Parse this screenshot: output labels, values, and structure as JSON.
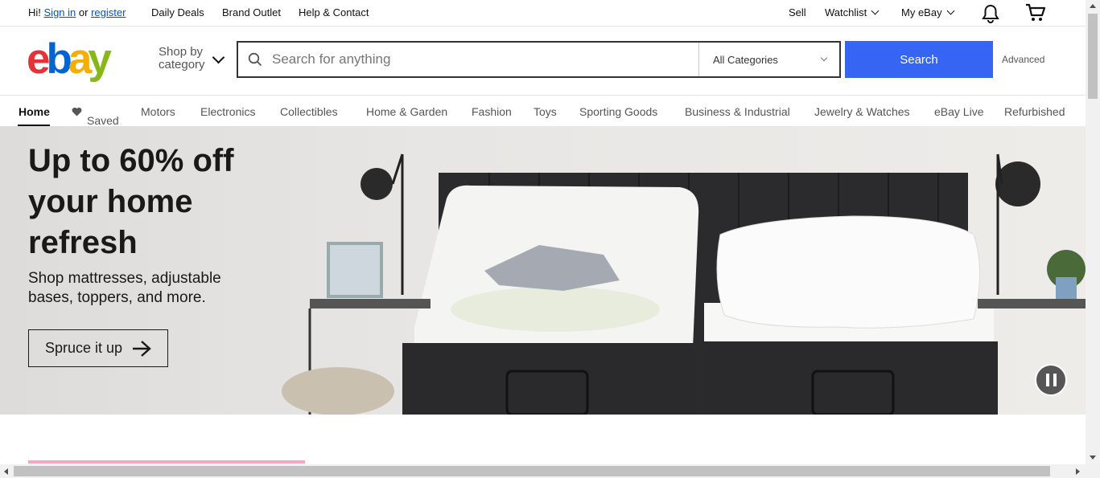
{
  "topbar": {
    "greeting": "Hi!",
    "sign_in": "Sign in",
    "or": "or",
    "register": "register",
    "daily_deals": "Daily Deals",
    "brand_outlet": "Brand Outlet",
    "help_contact": "Help & Contact",
    "sell": "Sell",
    "watchlist": "Watchlist",
    "my_ebay": "My eBay"
  },
  "header": {
    "logo": {
      "e": "e",
      "b": "b",
      "a": "a",
      "y": "y"
    },
    "shop_by_line1": "Shop by",
    "shop_by_line2": "category",
    "search_placeholder": "Search for anything",
    "category_select": "All Categories",
    "search_button": "Search",
    "advanced": "Advanced"
  },
  "nav": {
    "items": [
      "Home",
      "Saved",
      "Motors",
      "Electronics",
      "Collectibles",
      "Home & Garden",
      "Fashion",
      "Toys",
      "Sporting Goods",
      "Business & Industrial",
      "Jewelry & Watches",
      "eBay Live",
      "Refurbished"
    ],
    "active": "Home"
  },
  "hero": {
    "title": "Up to 60% off your home refresh",
    "subtitle": "Shop mattresses, adjustable bases, toppers, and more.",
    "cta": "Spruce it up"
  },
  "colors": {
    "link": "#0654ba",
    "search_button": "#3665f3",
    "logo_e": "#e53238",
    "logo_b": "#0064d2",
    "logo_a": "#f5af02",
    "logo_y": "#86b817",
    "promo_bar": "#f4a7c4"
  },
  "icons": [
    "notification-bell-icon",
    "cart-icon",
    "search-icon",
    "heart-icon",
    "arrow-right-icon",
    "pause-icon"
  ]
}
